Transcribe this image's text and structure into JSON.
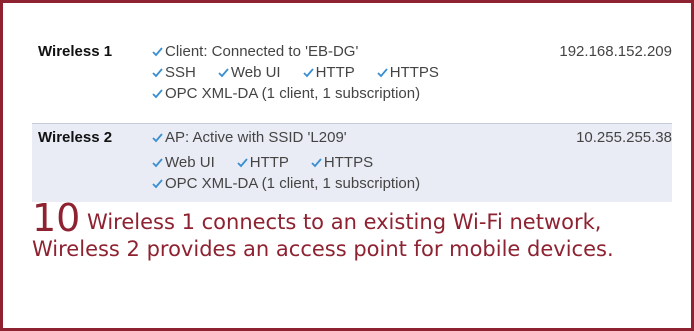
{
  "accent_color": "#8e2231",
  "check_color": "#3b8fd1",
  "interfaces": [
    {
      "name": "Wireless 1",
      "status": "Client: Connected to 'EB-DG'",
      "ip": "192.168.152.209",
      "services": [
        "SSH",
        "Web UI",
        "HTTP",
        "HTTPS"
      ],
      "opc": "OPC XML-DA (1 client, 1 subscription)"
    },
    {
      "name": "Wireless 2",
      "status": "AP: Active with SSID 'L209'",
      "ip": "10.255.255.38",
      "services": [
        "Web UI",
        "HTTP",
        "HTTPS"
      ],
      "opc": "OPC XML-DA (1 client, 1 subscription)"
    }
  ],
  "caption": {
    "number": "10",
    "text": "Wireless 1 connects to an existing Wi-Fi network, Wireless 2 provides an access point for mobile devices."
  }
}
